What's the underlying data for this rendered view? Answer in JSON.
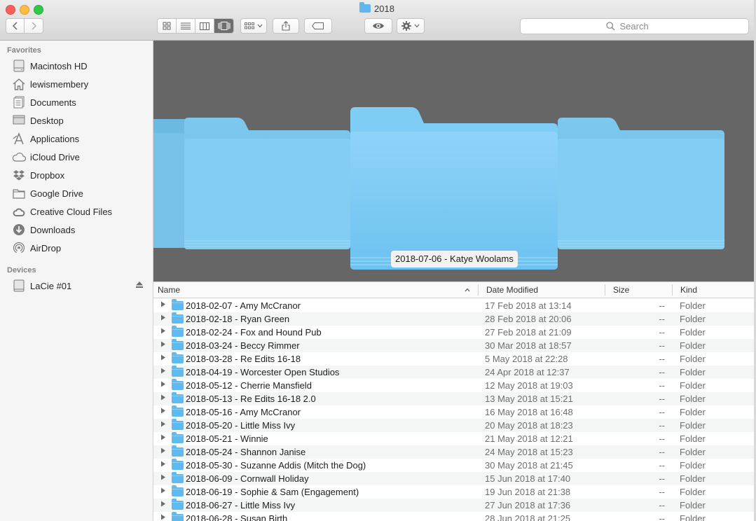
{
  "window": {
    "title": "2018"
  },
  "toolbar": {
    "search_placeholder": "Search",
    "view_modes": [
      "icon-view",
      "list-view",
      "column-view",
      "cover-flow-view"
    ],
    "active_view": "cover-flow-view"
  },
  "sidebar": {
    "favorites_heading": "Favorites",
    "favorites": [
      {
        "label": "Macintosh HD",
        "icon": "hard-drive-icon"
      },
      {
        "label": "lewismembery",
        "icon": "home-icon"
      },
      {
        "label": "Documents",
        "icon": "document-icon"
      },
      {
        "label": "Desktop",
        "icon": "desktop-icon"
      },
      {
        "label": "Applications",
        "icon": "applications-icon"
      },
      {
        "label": "iCloud Drive",
        "icon": "cloud-icon"
      },
      {
        "label": "Dropbox",
        "icon": "dropbox-icon"
      },
      {
        "label": "Google Drive",
        "icon": "folder-icon"
      },
      {
        "label": "Creative Cloud Files",
        "icon": "creative-cloud-icon"
      },
      {
        "label": "Downloads",
        "icon": "download-icon"
      },
      {
        "label": "AirDrop",
        "icon": "airdrop-icon"
      }
    ],
    "devices_heading": "Devices",
    "devices": [
      {
        "label": "LaCie #01",
        "icon": "external-drive-icon"
      }
    ]
  },
  "coverflow": {
    "selected_caption": "2018-07-06 - Katye Woolams"
  },
  "columns": {
    "name": "Name",
    "date": "Date Modified",
    "size": "Size",
    "kind": "Kind"
  },
  "files": [
    {
      "name": "2018-02-07 - Amy McCranor",
      "date": "17 Feb 2018 at 13:14",
      "size": "--",
      "kind": "Folder"
    },
    {
      "name": "2018-02-18 - Ryan Green",
      "date": "28 Feb 2018 at 20:06",
      "size": "--",
      "kind": "Folder"
    },
    {
      "name": "2018-02-24 - Fox and Hound Pub",
      "date": "27 Feb 2018 at 21:09",
      "size": "--",
      "kind": "Folder"
    },
    {
      "name": "2018-03-24 - Beccy Rimmer",
      "date": "30 Mar 2018 at 18:57",
      "size": "--",
      "kind": "Folder"
    },
    {
      "name": "2018-03-28 - Re Edits 16-18",
      "date": "5 May 2018 at 22:28",
      "size": "--",
      "kind": "Folder"
    },
    {
      "name": "2018-04-19 - Worcester Open Studios",
      "date": "24 Apr 2018 at 12:37",
      "size": "--",
      "kind": "Folder"
    },
    {
      "name": "2018-05-12 - Cherrie Mansfield",
      "date": "12 May 2018 at 19:03",
      "size": "--",
      "kind": "Folder"
    },
    {
      "name": "2018-05-13 - Re Edits 16-18 2.0",
      "date": "13 May 2018 at 15:21",
      "size": "--",
      "kind": "Folder"
    },
    {
      "name": "2018-05-16 - Amy McCranor",
      "date": "16 May 2018 at 16:48",
      "size": "--",
      "kind": "Folder"
    },
    {
      "name": "2018-05-20 - Little Miss Ivy",
      "date": "20 May 2018 at 18:23",
      "size": "--",
      "kind": "Folder"
    },
    {
      "name": "2018-05-21 - Winnie",
      "date": "21 May 2018 at 12:21",
      "size": "--",
      "kind": "Folder"
    },
    {
      "name": "2018-05-24 - Shannon Janise",
      "date": "24 May 2018 at 15:23",
      "size": "--",
      "kind": "Folder"
    },
    {
      "name": "2018-05-30 - Suzanne Addis (Mitch the Dog)",
      "date": "30 May 2018 at 21:45",
      "size": "--",
      "kind": "Folder"
    },
    {
      "name": "2018-06-09 - Cornwall Holiday",
      "date": "15 Jun 2018 at 17:40",
      "size": "--",
      "kind": "Folder"
    },
    {
      "name": "2018-06-19 - Sophie & Sam (Engagement)",
      "date": "19 Jun 2018 at 21:38",
      "size": "--",
      "kind": "Folder"
    },
    {
      "name": "2018-06-27 - Little Miss Ivy",
      "date": "27 Jun 2018 at 17:36",
      "size": "--",
      "kind": "Folder"
    },
    {
      "name": "2018-06-28 - Susan Birth",
      "date": "28 Jun 2018 at 21:25",
      "size": "--",
      "kind": "Folder"
    }
  ]
}
